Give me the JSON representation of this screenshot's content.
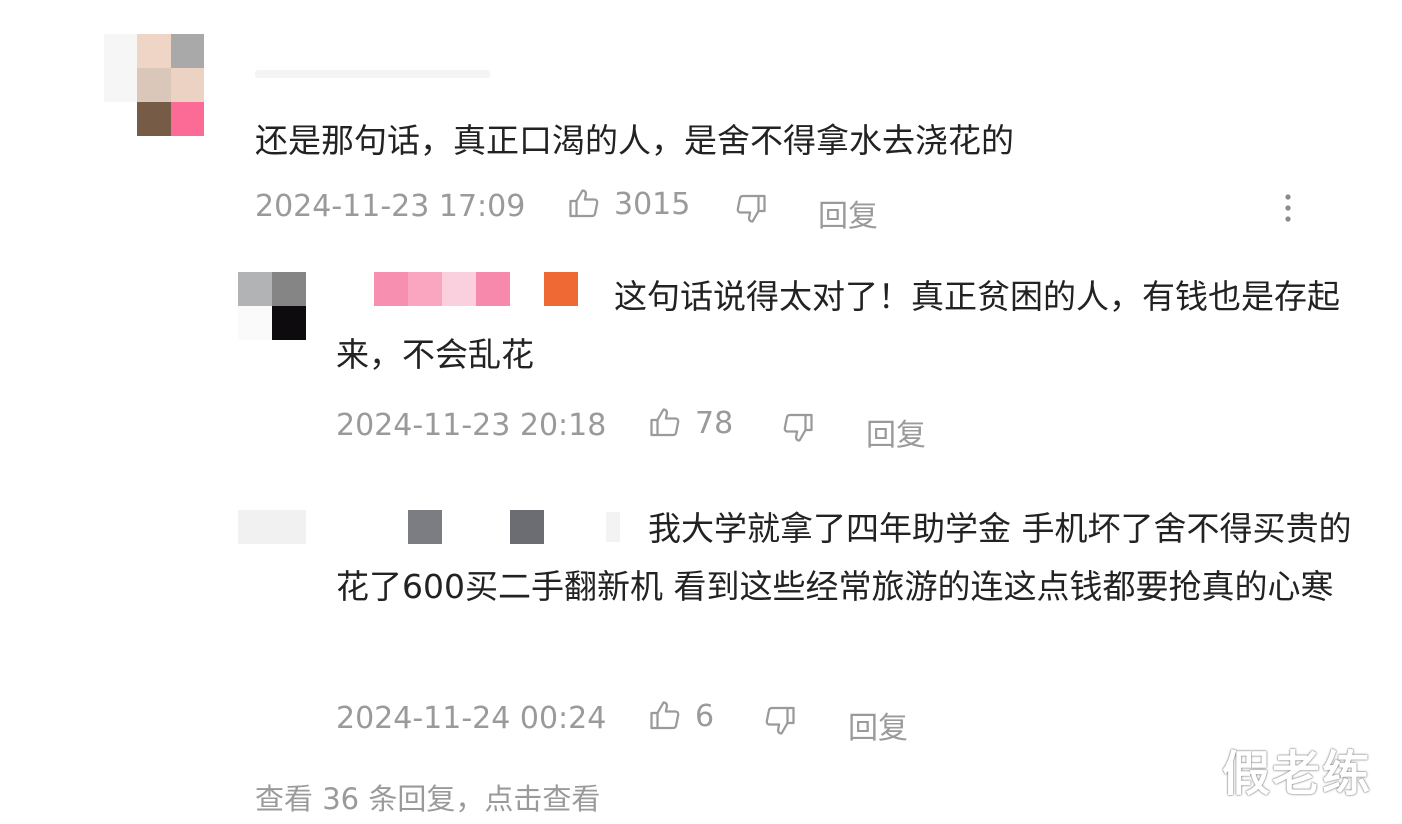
{
  "comment": {
    "text": "还是那句话，真正口渴的人，是舍不得拿水去浇花的",
    "timestamp": "2024-11-23 17:09",
    "likes": "3015",
    "reply_label": "回复"
  },
  "replies": [
    {
      "text": "这句话说得太对了！真正贫困的人，有钱也是存起来，不会乱花",
      "timestamp": "2024-11-23 20:18",
      "likes": "78",
      "reply_label": "回复"
    },
    {
      "text": "我大学就拿了四年助学金 手机坏了舍不得买贵的 花了600买二手翻新机 看到这些经常旅游的连这点钱都要抢真的心寒",
      "timestamp": "2024-11-24 00:24",
      "likes": "6",
      "reply_label": "回复"
    }
  ],
  "view_more": "查看 36 条回复，点击查看",
  "watermark": "假老练",
  "icons": {
    "like": "thumbs-up-icon",
    "dislike": "thumbs-down-icon",
    "more": "more-vertical-icon"
  },
  "colors": {
    "text": "#222222",
    "meta": "#9a9a9a",
    "background": "#ffffff"
  }
}
